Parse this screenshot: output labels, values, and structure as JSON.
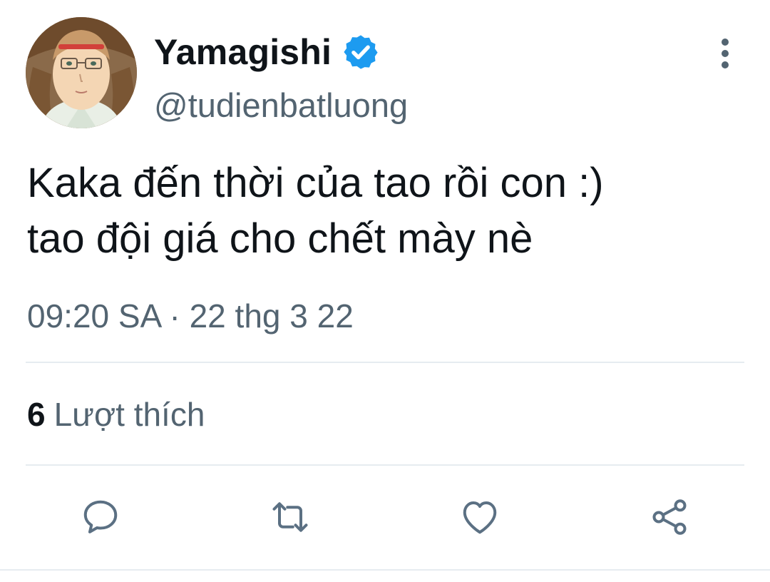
{
  "tweet": {
    "author": {
      "display_name": "Yamagishi",
      "handle": "@tudienbatluong",
      "verified": true,
      "avatar_icon": "anime-character-avatar"
    },
    "text_lines": [
      "Kaka đến thời của tao rồi con :)",
      "tao đội giá cho chết mày nè"
    ],
    "timestamp": "09:20 SA · 22 thg 3 22",
    "likes": {
      "count": "6",
      "label": "Lượt thích"
    },
    "actions": [
      {
        "name": "reply",
        "icon": "comment-icon"
      },
      {
        "name": "retweet",
        "icon": "retweet-icon"
      },
      {
        "name": "like",
        "icon": "heart-icon"
      },
      {
        "name": "share",
        "icon": "share-icon"
      }
    ]
  },
  "colors": {
    "primary_text": "#0f1419",
    "secondary_text": "#536471",
    "verified_blue": "#1d9bf0",
    "divider": "#e6ecf0",
    "icon": "#5b7083"
  }
}
